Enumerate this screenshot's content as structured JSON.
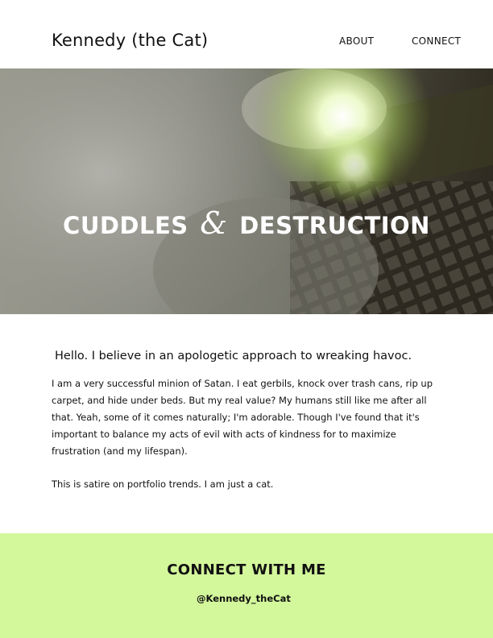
{
  "header": {
    "site_title": "Kennedy (the Cat)",
    "nav": {
      "about": "ABOUT",
      "connect": "CONNECT"
    }
  },
  "hero": {
    "title_left": "CUDDLES",
    "ampersand": "&",
    "title_right": "DESTRUCTION"
  },
  "main": {
    "intro_heading": "Hello. I believe in an apologetic approach to wreaking havoc.",
    "body": "I am a very successful minion of Satan. I eat gerbils, knock over trash cans, rip up carpet, and hide under beds. But my real value? My humans still like me after all that. Yeah, some of it comes naturally; I'm adorable. Though I've found that it's important to balance my acts of evil with acts of kindness for to maximize frustration (and my lifespan).",
    "satire_note": "This is satire on portfolio trends. I am just a cat."
  },
  "footer": {
    "title": "CONNECT WITH ME",
    "handle": "@Kennedy_theCat"
  },
  "colors": {
    "footer_bg": "#d3f79b",
    "text": "#111111",
    "hero_text": "#ffffff"
  }
}
